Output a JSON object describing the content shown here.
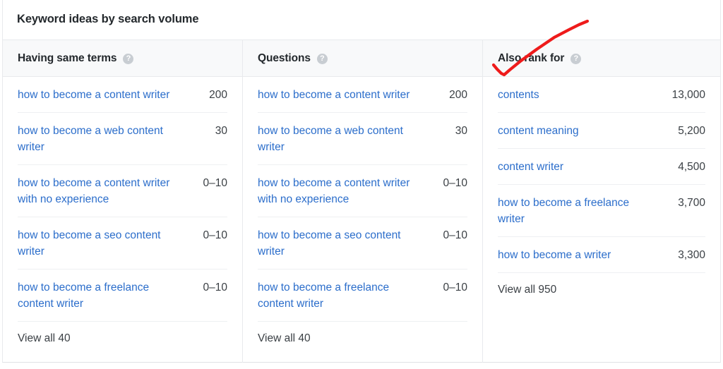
{
  "widget": {
    "title": "Keyword ideas by search volume",
    "help_icon": "help-circle-icon",
    "help_glyph": "?",
    "link_color": "#2c6ecb",
    "text_color": "#3b4045",
    "header_bg": "#f8f9fa",
    "border_color": "#e8eaed",
    "annotation_color": "#ee1b1b"
  },
  "columns": [
    {
      "header": "Having same terms",
      "view_all": "View all 40",
      "rows": [
        {
          "keyword": "how to become a content writer",
          "volume": "200"
        },
        {
          "keyword": "how to become a web content writer",
          "volume": "30"
        },
        {
          "keyword": "how to become a content writer with no experience",
          "volume": "0–10"
        },
        {
          "keyword": "how to become a seo content writer",
          "volume": "0–10"
        },
        {
          "keyword": "how to become a freelance content writer",
          "volume": "0–10"
        }
      ]
    },
    {
      "header": "Questions",
      "view_all": "View all 40",
      "rows": [
        {
          "keyword": "how to become a content writer",
          "volume": "200"
        },
        {
          "keyword": "how to become a web content writer",
          "volume": "30"
        },
        {
          "keyword": "how to become a content writer with no experience",
          "volume": "0–10"
        },
        {
          "keyword": "how to become a seo content writer",
          "volume": "0–10"
        },
        {
          "keyword": "how to become a freelance content writer",
          "volume": "0–10"
        }
      ]
    },
    {
      "header": "Also rank for",
      "view_all": "View all 950",
      "rows": [
        {
          "keyword": "contents",
          "volume": "13,000"
        },
        {
          "keyword": "content meaning",
          "volume": "5,200"
        },
        {
          "keyword": "content writer",
          "volume": "4,500"
        },
        {
          "keyword": "how to become a freelance writer",
          "volume": "3,700"
        },
        {
          "keyword": "how to become a writer",
          "volume": "3,300"
        }
      ]
    }
  ]
}
